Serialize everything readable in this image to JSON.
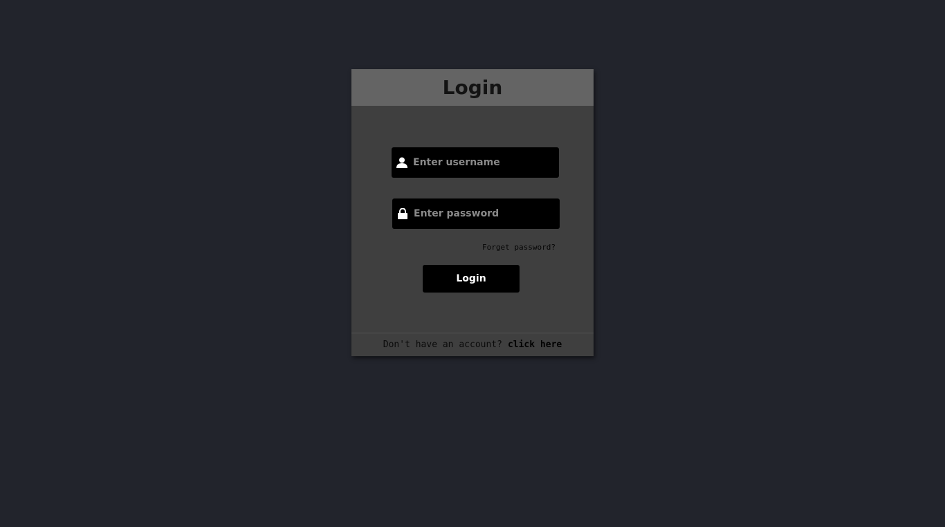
{
  "page": {
    "background_color": "#22242c"
  },
  "card": {
    "title": "Login",
    "header_color": "#646464",
    "body_color": "#3f3f3f"
  },
  "username": {
    "icon": "user-icon",
    "placeholder": "Enter username",
    "value": ""
  },
  "password": {
    "icon": "lock-icon",
    "placeholder": "Enter password",
    "value": ""
  },
  "forgot_password": {
    "label": "Forget password?"
  },
  "login_button": {
    "label": "Login"
  },
  "footer": {
    "prompt": "Don't have an account?",
    "link_label": "click here"
  }
}
